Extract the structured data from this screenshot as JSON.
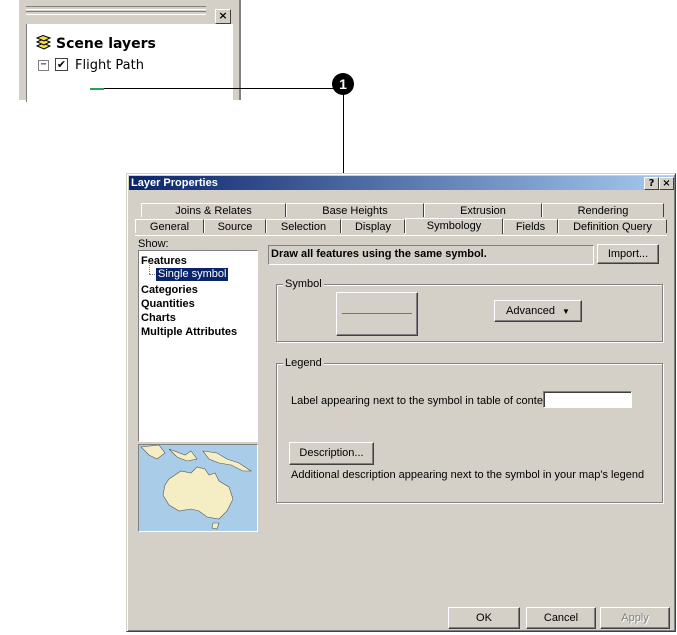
{
  "toc": {
    "title": "Scene layers",
    "layer_name": "Flight Path",
    "layer_checked": "✔",
    "expand_glyph": "−",
    "close_glyph": "×",
    "icon": "scene-layers-icon"
  },
  "callout": {
    "number": "1"
  },
  "dialog": {
    "title": "Layer Properties",
    "help_glyph": "?",
    "close_glyph": "×",
    "tabs_back": [
      "Joins & Relates",
      "Base Heights",
      "Extrusion",
      "Rendering"
    ],
    "tabs_front": [
      "General",
      "Source",
      "Selection",
      "Display",
      "Symbology",
      "Fields",
      "Definition Query"
    ],
    "active_tab": "Symbology",
    "show_label": "Show:",
    "show_items": {
      "features": "Features",
      "single_symbol": "Single symbol",
      "categories": "Categories",
      "quantities": "Quantities",
      "charts": "Charts",
      "multiple_attributes": "Multiple Attributes"
    },
    "description_header": "Draw all features using the same symbol.",
    "import_button": "Import...",
    "symbol_group": "Symbol",
    "advanced_button": "Advanced",
    "legend_group": "Legend",
    "label_prompt": "Label appearing next to the symbol in table of contents:",
    "label_value": "",
    "description_button": "Description...",
    "description_help": "Additional description appearing next to the symbol in your map's legend",
    "ok_button": "OK",
    "cancel_button": "Cancel",
    "apply_button": "Apply"
  },
  "colors": {
    "symbol_line": "#2e9e5b",
    "titlebar_start": "#0a246a",
    "titlebar_end": "#a6caf0",
    "dialog_face": "#d4d0c8",
    "selection": "#0a246a",
    "map_water": "#a9cde9",
    "map_land": "#f5edc4"
  }
}
